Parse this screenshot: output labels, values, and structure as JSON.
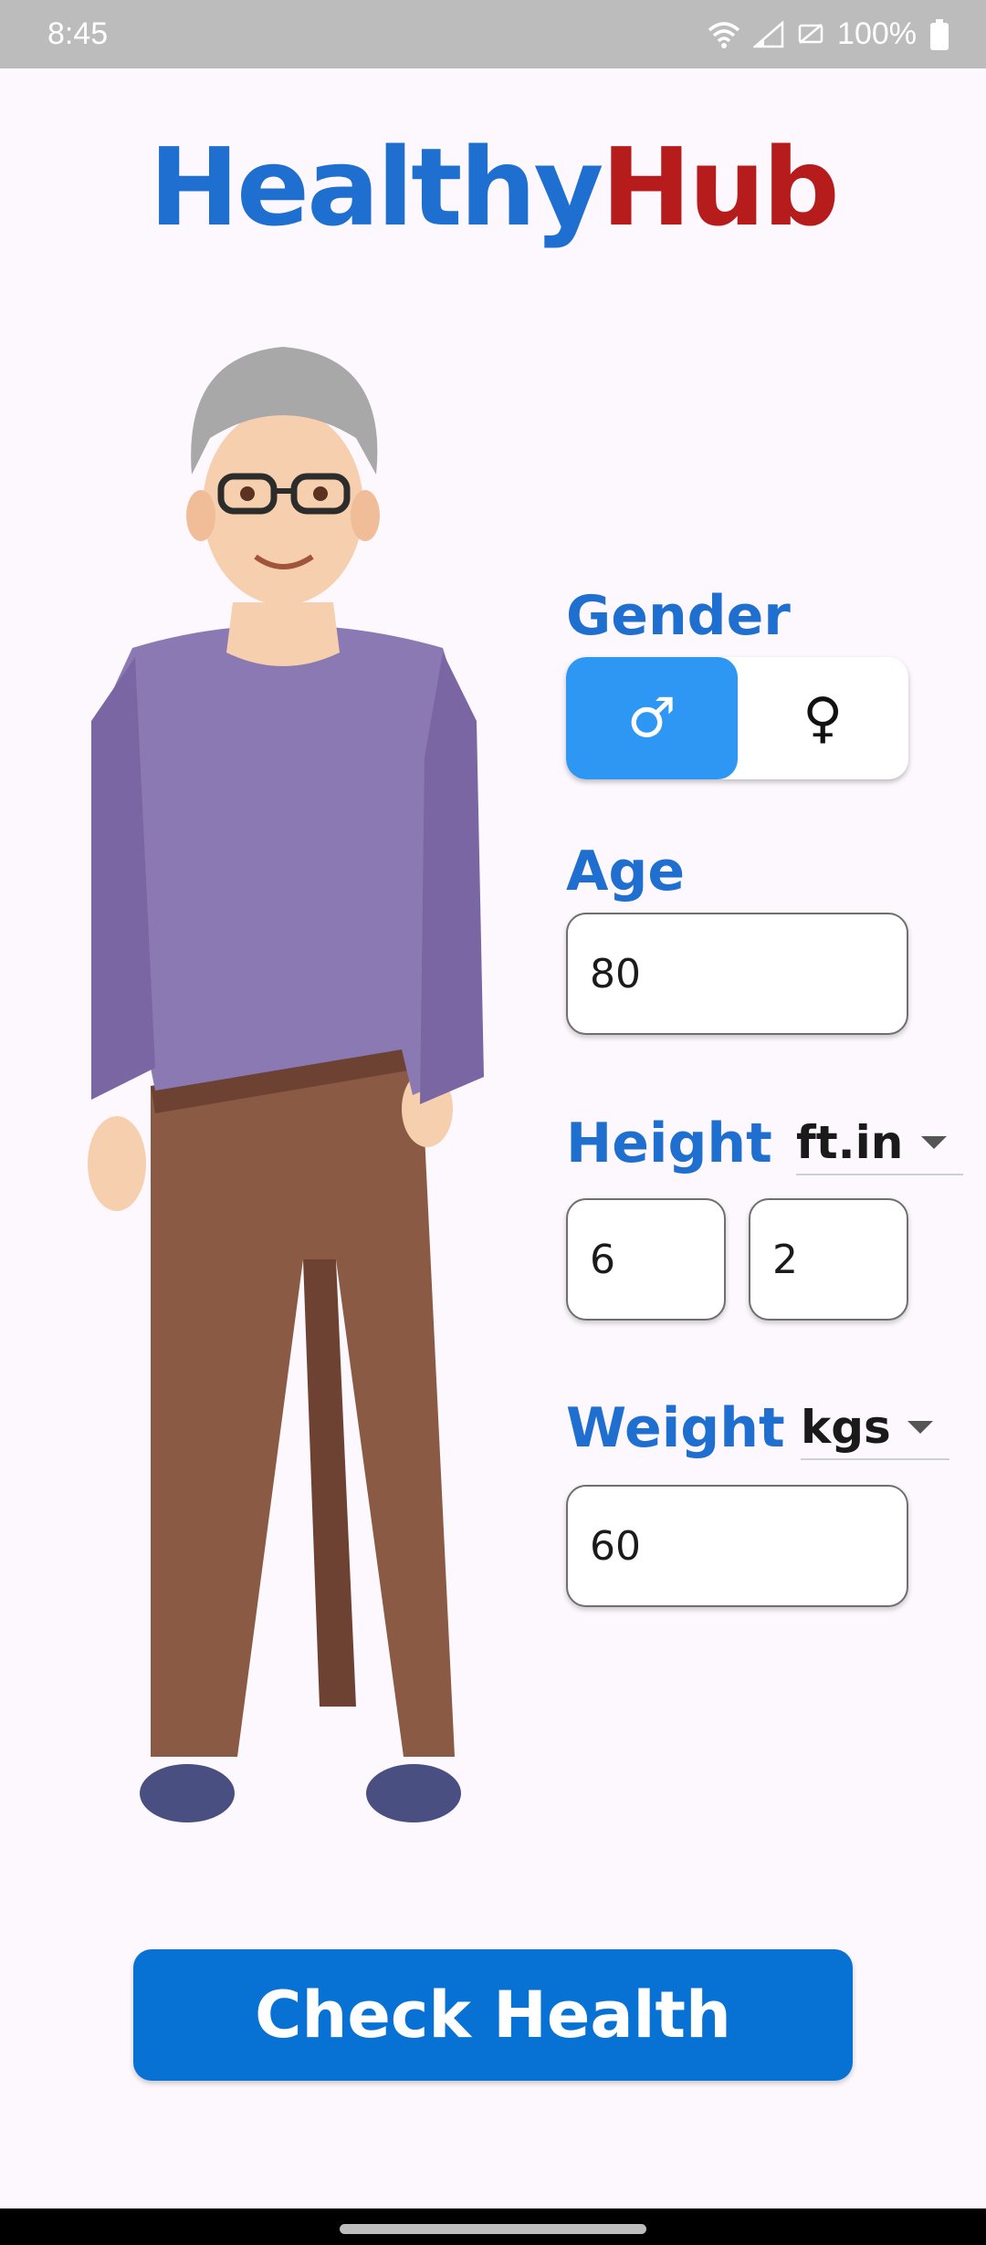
{
  "status_bar": {
    "time": "8:45",
    "battery": "100%",
    "icons": [
      "wifi-icon",
      "signal-icon",
      "no-sim-icon",
      "battery-icon"
    ]
  },
  "app": {
    "logo_part1": "Healthy",
    "logo_part2": "Hub",
    "logo_colors": {
      "part1": "#1f6fd0",
      "part2": "#b71c1c"
    }
  },
  "form": {
    "gender": {
      "label": "Gender",
      "options": [
        {
          "symbol": "♂",
          "name": "male",
          "selected": true
        },
        {
          "symbol": "♀",
          "name": "female",
          "selected": false
        }
      ]
    },
    "age": {
      "label": "Age",
      "value": "80"
    },
    "height": {
      "label": "Height",
      "unit": "ft.in",
      "feet": "6",
      "inches": "2"
    },
    "weight": {
      "label": "Weight",
      "unit": "kgs",
      "value": "60"
    }
  },
  "action": {
    "check_label": "Check Health"
  },
  "colors": {
    "accent": "#1f6fd0",
    "button": "#0872d4",
    "toggle_active": "#2e96f3"
  }
}
